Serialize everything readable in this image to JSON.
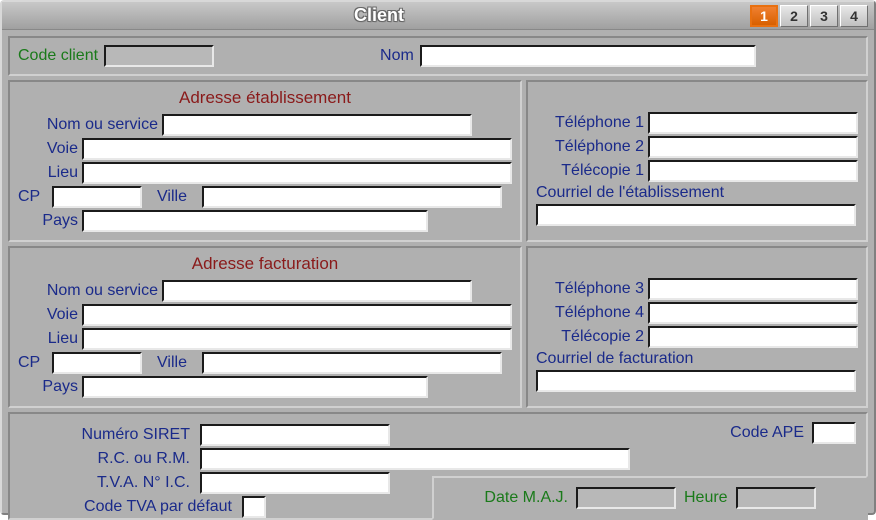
{
  "window": {
    "title": "Client"
  },
  "tabs": [
    "1",
    "2",
    "3",
    "4"
  ],
  "activeTab": "1",
  "top": {
    "code_label": "Code client",
    "code_value": "",
    "nom_label": "Nom",
    "nom_value": ""
  },
  "addr_etab": {
    "title": "Adresse établissement",
    "nom_service_label": "Nom ou service",
    "voie_label": "Voie",
    "lieu_label": "Lieu",
    "cp_label": "CP",
    "ville_label": "Ville",
    "pays_label": "Pays",
    "nom_service": "",
    "voie": "",
    "lieu": "",
    "cp": "",
    "ville": "",
    "pays": ""
  },
  "contact_etab": {
    "tel1_label": "Téléphone 1",
    "tel2_label": "Téléphone 2",
    "fax1_label": "Télécopie 1",
    "email_label": "Courriel de l'établissement",
    "tel1": "",
    "tel2": "",
    "fax1": "",
    "email": ""
  },
  "addr_fact": {
    "title": "Adresse facturation",
    "nom_service_label": "Nom ou service",
    "voie_label": "Voie",
    "lieu_label": "Lieu",
    "cp_label": "CP",
    "ville_label": "Ville",
    "pays_label": "Pays",
    "nom_service": "",
    "voie": "",
    "lieu": "",
    "cp": "",
    "ville": "",
    "pays": ""
  },
  "contact_fact": {
    "tel3_label": "Téléphone 3",
    "tel4_label": "Téléphone 4",
    "fax2_label": "Télécopie 2",
    "email_label": "Courriel de facturation",
    "tel3": "",
    "tel4": "",
    "fax2": "",
    "email": ""
  },
  "bottom": {
    "siret_label": "Numéro SIRET",
    "rc_label": "R.C. ou R.M.",
    "tva_ic_label": "T.V.A. N° I.C.",
    "code_tva_label": "Code TVA par défaut",
    "code_ape_label": "Code APE",
    "siret": "",
    "rc": "",
    "tva_ic": "",
    "code_tva": "",
    "code_ape": ""
  },
  "maj": {
    "date_label": "Date M.A.J.",
    "heure_label": "Heure",
    "date": "",
    "heure": ""
  }
}
